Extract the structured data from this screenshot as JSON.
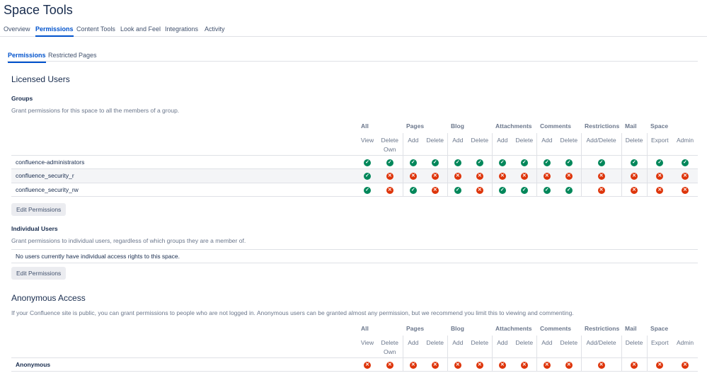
{
  "title": "Space Tools",
  "tabs": [
    "Overview",
    "Permissions",
    "Content Tools",
    "Look and Feel",
    "Integrations",
    "Activity"
  ],
  "active_tab": "Permissions",
  "subtabs": [
    "Permissions",
    "Restricted Pages"
  ],
  "active_subtab": "Permissions",
  "colors": {
    "accent": "#0052cc",
    "yes": "#00875a",
    "no": "#de350b"
  },
  "licensed": {
    "heading": "Licensed Users",
    "groups_heading": "Groups",
    "groups_desc": "Grant permissions for this space to all the members of a group.",
    "edit_label": "Edit Permissions",
    "individual_heading": "Individual Users",
    "individual_desc": "Grant permissions to individual users, regardless of which groups they are a member of.",
    "individual_empty": "No users currently have individual access rights to this space.",
    "edit_label2": "Edit Permissions"
  },
  "anonymous": {
    "heading": "Anonymous Access",
    "desc": "If your Confluence site is public, you can grant permissions to people who are not logged in. Anonymous users can be granted almost any permission, but we recommend you limit this to viewing and commenting."
  },
  "column_groups": [
    {
      "label": "All",
      "span": 2
    },
    {
      "label": "Pages",
      "span": 2
    },
    {
      "label": "Blog",
      "span": 2
    },
    {
      "label": "Attachments",
      "span": 2
    },
    {
      "label": "Comments",
      "span": 2
    },
    {
      "label": "Restrictions",
      "span": 1
    },
    {
      "label": "Mail",
      "span": 1
    },
    {
      "label": "Space",
      "span": 2
    }
  ],
  "columns": [
    "View",
    "Delete Own",
    "Add",
    "Delete",
    "Add",
    "Delete",
    "Add",
    "Delete",
    "Add",
    "Delete",
    "Add/Delete",
    "Delete",
    "Export",
    "Admin"
  ],
  "group_rows": [
    {
      "name": "confluence-administrators",
      "perms": [
        1,
        1,
        1,
        1,
        1,
        1,
        1,
        1,
        1,
        1,
        1,
        1,
        1,
        1
      ]
    },
    {
      "name": "confluence_security_r",
      "perms": [
        1,
        0,
        0,
        0,
        0,
        0,
        0,
        0,
        0,
        0,
        0,
        0,
        0,
        0
      ]
    },
    {
      "name": "confluence_security_rw",
      "perms": [
        1,
        0,
        1,
        0,
        1,
        0,
        1,
        1,
        1,
        1,
        0,
        0,
        0,
        0
      ]
    }
  ],
  "anon_rows": [
    {
      "name": "Anonymous",
      "perms": [
        0,
        0,
        0,
        0,
        0,
        0,
        0,
        0,
        0,
        0,
        0,
        0,
        0,
        0
      ]
    }
  ]
}
